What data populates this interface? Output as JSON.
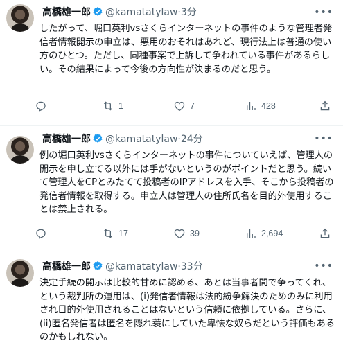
{
  "tweets": [
    {
      "name": "高橋雄一郎",
      "handle": "@kamatatylaw",
      "dot": "·",
      "time": "3分",
      "text": "したがって、堀口英利vsさくらインターネットの事件のような管理者発信者情報開示の申立は、悪用のおそれはあれど、現行法上は普通の使い方のひとつ。ただし、同種事案で上訴して争われている事件があるらしい。その結果によって今後の方向性が決まるのだと思う。",
      "replies": "",
      "retweets": "1",
      "likes": "7",
      "views": "428"
    },
    {
      "name": "高橋雄一郎",
      "handle": "@kamatatylaw",
      "dot": "·",
      "time": "24分",
      "text": "例の堀口英利vsさくらインターネットの事件についていえば、管理人の開示を申し立てる以外には手がないというのがポイントだと思う。続いて管理人をCPとみたてて投稿者のIPアドレスを入手、そこから投稿者の発信者情報を取得する。申立人は管理人の住所氏名を目的外使用することは禁止される。",
      "replies": "",
      "retweets": "17",
      "likes": "39",
      "views": "2,694"
    },
    {
      "name": "高橋雄一郎",
      "handle": "@kamatatylaw",
      "dot": "·",
      "time": "33分",
      "text": "決定手続の開示は比較的甘めに認める、あとは当事者間で争ってくれ、という裁判所の運用は、(i)発信者情報は法的紛争解決のためのみに利用され目的外使用されることはないという信頼に依拠している。さらに、(ii)匿名発信者は匿名を隠れ蓑にしていた卑怯な奴らだという評価もあるのかもしれない。"
    }
  ],
  "colors": {
    "verified": "#1d9bf0",
    "muted": "#536471",
    "text": "#0f1419"
  }
}
